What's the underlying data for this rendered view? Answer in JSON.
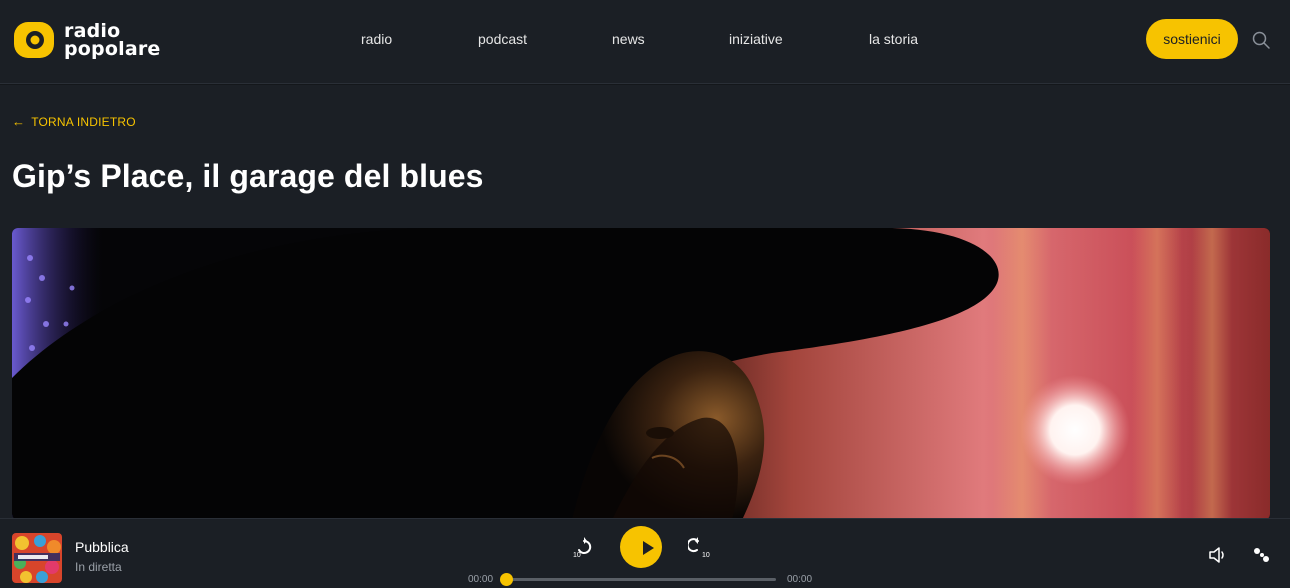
{
  "brand": {
    "name_line1": "radio",
    "name_line2": "popolare",
    "accent": "#f7c300",
    "background": "#1b1f25"
  },
  "nav": {
    "items": [
      {
        "label": "radio"
      },
      {
        "label": "podcast"
      },
      {
        "label": "news"
      },
      {
        "label": "iniziative"
      },
      {
        "label": "la storia"
      }
    ],
    "cta_label": "sostienici",
    "search_icon": "search-icon"
  },
  "article": {
    "back_label": "TORNA INDIETRO",
    "back_icon": "arrow-left-icon",
    "title": "Gip’s Place, il garage del blues",
    "hero_image": "man-in-wide-brim-hat-silhouette"
  },
  "player": {
    "station": "Pubblica",
    "status": "In diretta",
    "thumbnail_icon": "pubblica-cover",
    "rewind_label": "10",
    "forward_label": "10",
    "time_current": "00:00",
    "time_total": "00:00",
    "progress": 0,
    "volume_icon": "speaker-icon",
    "extra_icon": "dots-icon"
  }
}
